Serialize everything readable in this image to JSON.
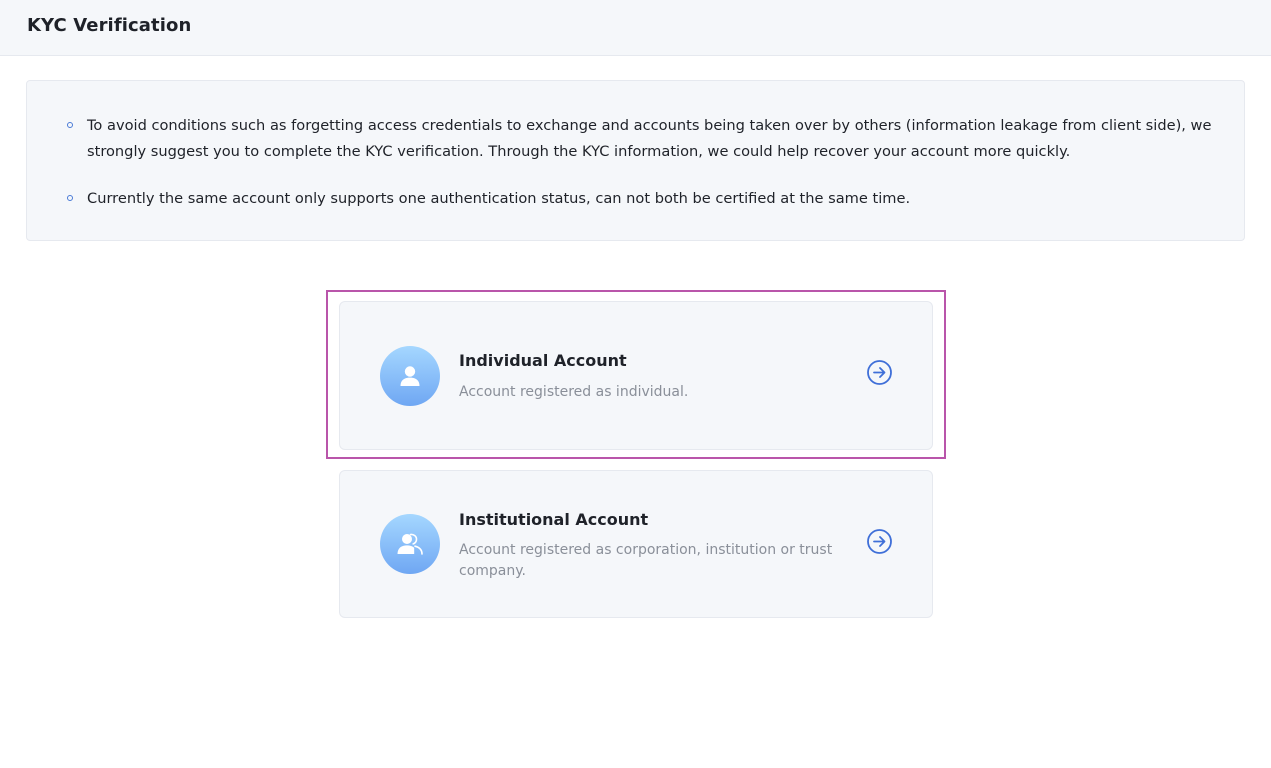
{
  "header": {
    "title": "KYC Verification"
  },
  "notice": {
    "items": [
      "To avoid conditions such as forgetting access credentials to exchange and accounts being taken over by others (information leakage from client side), we strongly suggest you to complete the KYC verification. Through the KYC information, we could help recover your account more quickly.",
      "Currently the same account only supports one authentication status, can not both be certified at the same time."
    ]
  },
  "account_types": [
    {
      "title": "Individual Account",
      "description": "Account registered as individual.",
      "icon": "person-icon",
      "action_icon": "arrow-right-circle-icon"
    },
    {
      "title": "Institutional Account",
      "description": "Account registered as corporation, institution or trust company.",
      "icon": "institution-person-icon",
      "action_icon": "arrow-right-circle-icon"
    }
  ],
  "colors": {
    "accent": "#3f6fd8",
    "highlight": "#b955aa",
    "avatar_top": "#a5d7ff",
    "avatar_bottom": "#6fa7f3"
  }
}
